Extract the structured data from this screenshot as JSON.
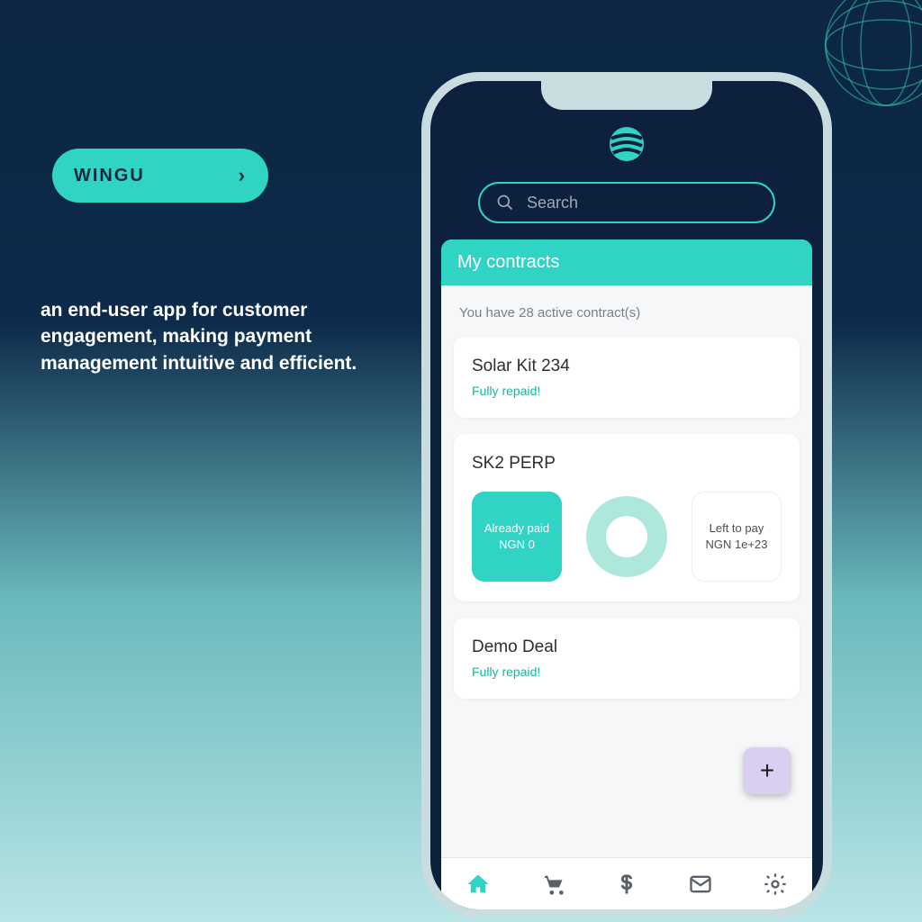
{
  "colors": {
    "accent": "#2fd4c5",
    "dark": "#0c2644"
  },
  "left": {
    "pill_label": "WINGU",
    "tagline": "an end-user app for customer engagement, making payment management intuitive and efficient."
  },
  "search": {
    "placeholder": "Search"
  },
  "panel": {
    "title": "My contracts",
    "summary": "You have 28 active contract(s)"
  },
  "contracts": [
    {
      "name": "Solar Kit 234",
      "status": "Fully repaid!"
    },
    {
      "name": "SK2 PERP",
      "paid_label": "Already paid",
      "paid_value": "NGN 0",
      "left_label": "Left to pay",
      "left_value": "NGN 1e+23"
    },
    {
      "name": "Demo Deal",
      "status": "Fully repaid!"
    }
  ],
  "fab": {
    "label": "+"
  },
  "nav": {
    "home": "home-icon",
    "cart": "cart-icon",
    "payments": "dollar-icon",
    "mail": "mail-icon",
    "settings": "gear-icon"
  }
}
